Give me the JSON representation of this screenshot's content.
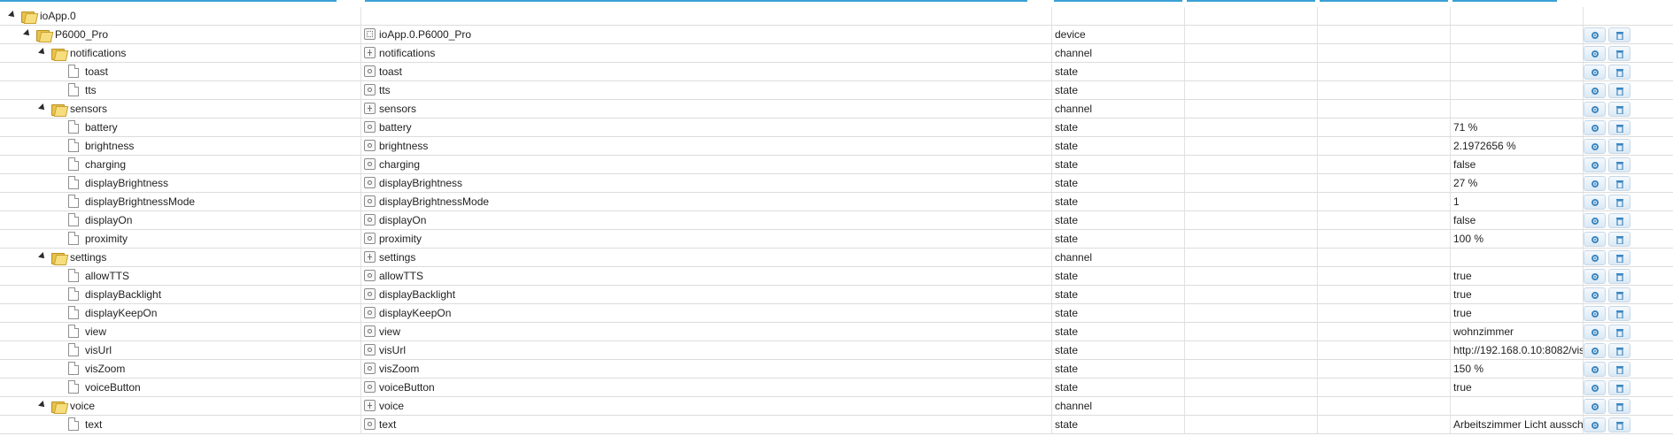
{
  "accent_color": "#3aa1d6",
  "rows": [
    {
      "name": "ioApp.0",
      "id": "",
      "type": "",
      "value": "",
      "level": 0,
      "kind": "folder",
      "obj": "none"
    },
    {
      "name": "P6000_Pro",
      "id": "ioApp.0.P6000_Pro",
      "type": "device",
      "value": "",
      "level": 1,
      "kind": "folder",
      "obj": "device"
    },
    {
      "name": "notifications",
      "id": "notifications",
      "type": "channel",
      "value": "",
      "level": 2,
      "kind": "folder",
      "obj": "channel"
    },
    {
      "name": "toast",
      "id": "toast",
      "type": "state",
      "value": "",
      "level": 3,
      "kind": "file",
      "obj": "state"
    },
    {
      "name": "tts",
      "id": "tts",
      "type": "state",
      "value": "",
      "level": 3,
      "kind": "file",
      "obj": "state"
    },
    {
      "name": "sensors",
      "id": "sensors",
      "type": "channel",
      "value": "",
      "level": 2,
      "kind": "folder",
      "obj": "channel"
    },
    {
      "name": "battery",
      "id": "battery",
      "type": "state",
      "value": "71 %",
      "level": 3,
      "kind": "file",
      "obj": "state"
    },
    {
      "name": "brightness",
      "id": "brightness",
      "type": "state",
      "value": "2.1972656 %",
      "level": 3,
      "kind": "file",
      "obj": "state"
    },
    {
      "name": "charging",
      "id": "charging",
      "type": "state",
      "value": "false",
      "level": 3,
      "kind": "file",
      "obj": "state"
    },
    {
      "name": "displayBrightness",
      "id": "displayBrightness",
      "type": "state",
      "value": "27 %",
      "level": 3,
      "kind": "file",
      "obj": "state"
    },
    {
      "name": "displayBrightnessMode",
      "id": "displayBrightnessMode",
      "type": "state",
      "value": "1",
      "level": 3,
      "kind": "file",
      "obj": "state"
    },
    {
      "name": "displayOn",
      "id": "displayOn",
      "type": "state",
      "value": "false",
      "level": 3,
      "kind": "file",
      "obj": "state"
    },
    {
      "name": "proximity",
      "id": "proximity",
      "type": "state",
      "value": "100 %",
      "level": 3,
      "kind": "file",
      "obj": "state"
    },
    {
      "name": "settings",
      "id": "settings",
      "type": "channel",
      "value": "",
      "level": 2,
      "kind": "folder",
      "obj": "channel"
    },
    {
      "name": "allowTTS",
      "id": "allowTTS",
      "type": "state",
      "value": "true",
      "level": 3,
      "kind": "file",
      "obj": "state"
    },
    {
      "name": "displayBacklight",
      "id": "displayBacklight",
      "type": "state",
      "value": "true",
      "level": 3,
      "kind": "file",
      "obj": "state"
    },
    {
      "name": "displayKeepOn",
      "id": "displayKeepOn",
      "type": "state",
      "value": "true",
      "level": 3,
      "kind": "file",
      "obj": "state"
    },
    {
      "name": "view",
      "id": "view",
      "type": "state",
      "value": "wohnzimmer",
      "level": 3,
      "kind": "file",
      "obj": "state"
    },
    {
      "name": "visUrl",
      "id": "visUrl",
      "type": "state",
      "value": "http://192.168.0.10:8082/vis",
      "level": 3,
      "kind": "file",
      "obj": "state"
    },
    {
      "name": "visZoom",
      "id": "visZoom",
      "type": "state",
      "value": "150 %",
      "level": 3,
      "kind": "file",
      "obj": "state"
    },
    {
      "name": "voiceButton",
      "id": "voiceButton",
      "type": "state",
      "value": "true",
      "level": 3,
      "kind": "file",
      "obj": "state"
    },
    {
      "name": "voice",
      "id": "voice",
      "type": "channel",
      "value": "",
      "level": 2,
      "kind": "folder",
      "obj": "channel"
    },
    {
      "name": "text",
      "id": "text",
      "type": "state",
      "value": "Arbeitszimmer Licht aussch",
      "level": 3,
      "kind": "file",
      "obj": "state"
    }
  ],
  "icons": {
    "edit": "gear-icon",
    "delete": "trash-icon"
  }
}
